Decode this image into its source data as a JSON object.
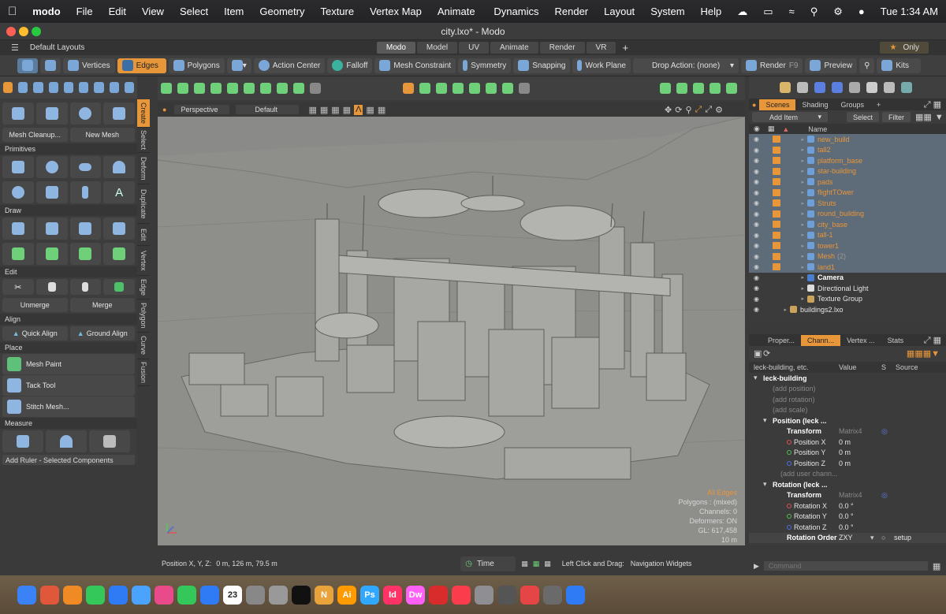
{
  "menubar": {
    "app": "modo",
    "items": [
      "File",
      "Edit",
      "View",
      "Select",
      "Item",
      "Geometry",
      "Texture",
      "Vertex Map",
      "Animate"
    ],
    "right_items": [
      "Dynamics",
      "Render",
      "Layout",
      "System",
      "Help"
    ],
    "clock": "Tue  1:34 AM"
  },
  "window": {
    "title": "city.lxo* - Modo"
  },
  "layoutbar": {
    "layouts_label": "Default Layouts",
    "tabs": [
      "Modo",
      "Model",
      "UV",
      "Animate",
      "Render",
      "VR"
    ],
    "add": "+",
    "only_label": "Only"
  },
  "toolbar": {
    "vertices": "Vertices",
    "edges": "Edges",
    "polygons": "Polygons",
    "action_center": "Action Center",
    "falloff": "Falloff",
    "mesh_constraint": "Mesh Constraint",
    "symmetry": "Symmetry",
    "snapping": "Snapping",
    "work_plane": "Work Plane",
    "drop_action": "Drop Action: (none)",
    "render": "Render",
    "render_key": "F9",
    "preview": "Preview",
    "kits": "Kits"
  },
  "left": {
    "mesh_cleanup": "Mesh Cleanup...",
    "new_mesh": "New Mesh",
    "sections": {
      "primitives": "Primitives",
      "draw": "Draw",
      "edit": "Edit",
      "align": "Align",
      "place": "Place",
      "measure": "Measure"
    },
    "unmerge": "Unmerge",
    "merge": "Merge",
    "quick_align": "Quick Align",
    "ground_align": "Ground Align",
    "mesh_paint": "Mesh Paint",
    "tack_tool": "Tack Tool",
    "stitch_mesh": "Stitch Mesh...",
    "add_ruler": "Add Ruler - Selected Components",
    "vtabs": [
      "Create",
      "Select",
      "Deform",
      "Duplicate",
      "Edit",
      "Vertex",
      "Edge",
      "Polygon",
      "Curve",
      "Fusion"
    ]
  },
  "viewport": {
    "view": "Perspective",
    "shading": "Default",
    "hud": {
      "all_edges": "All Edges",
      "polygons": "Polygons : (mixed)",
      "channels": "Channels: 0",
      "deformers": "Deformers: ON",
      "gl": "GL: 617,458",
      "scale": "10 m"
    }
  },
  "statusbar": {
    "position_label": "Position X, Y, Z:",
    "position_value": "0 m, 126 m, 79.5 m",
    "time": "Time",
    "hint_action": "Left Click and Drag:",
    "hint_target": "Navigation Widgets"
  },
  "scenes": {
    "tabs": [
      "Scenes",
      "Shading",
      "Groups",
      "+"
    ],
    "add_item": "Add Item",
    "select": "Select",
    "filter": "Filter",
    "name_header": "Name",
    "items": [
      {
        "name": "new_build",
        "type": "mesh",
        "selected": true
      },
      {
        "name": "tall2",
        "type": "mesh",
        "selected": true
      },
      {
        "name": "platform_base",
        "type": "mesh",
        "selected": true
      },
      {
        "name": "star-building",
        "type": "mesh",
        "selected": true
      },
      {
        "name": "pads",
        "type": "mesh",
        "selected": true
      },
      {
        "name": "flightTOwer",
        "type": "mesh",
        "selected": true
      },
      {
        "name": "Struts",
        "type": "mesh",
        "selected": true
      },
      {
        "name": "round_building",
        "type": "mesh",
        "selected": true
      },
      {
        "name": "city_base",
        "type": "mesh",
        "selected": true
      },
      {
        "name": "tall-1",
        "type": "mesh",
        "selected": true
      },
      {
        "name": "tower1",
        "type": "mesh",
        "selected": true
      },
      {
        "name": "Mesh",
        "count": "(2)",
        "type": "mesh",
        "selected": true
      },
      {
        "name": "land1",
        "type": "mesh",
        "selected": true
      },
      {
        "name": "Camera",
        "type": "camera",
        "selected": false
      },
      {
        "name": "Directional Light",
        "type": "light",
        "selected": false
      },
      {
        "name": "Texture Group",
        "type": "texture",
        "selected": false
      },
      {
        "name": "buildings2.lxo",
        "type": "scene",
        "selected": false
      }
    ]
  },
  "channels": {
    "tabs": [
      "Proper...",
      "Chann...",
      "Vertex ...",
      "Stats"
    ],
    "headers": {
      "name": "leck-building, etc.",
      "value": "Value",
      "s": "S",
      "source": "Source"
    },
    "rows": [
      {
        "label": "leck-building",
        "value": "",
        "kind": "item",
        "indent": 18
      },
      {
        "label": "(add position)",
        "value": "",
        "kind": "dim",
        "indent": 30
      },
      {
        "label": "(add rotation)",
        "value": "",
        "kind": "dim",
        "indent": 30
      },
      {
        "label": "(add scale)",
        "value": "",
        "kind": "dim",
        "indent": 30
      },
      {
        "label": "Position (leck ...",
        "value": "",
        "kind": "group",
        "indent": 30
      },
      {
        "label": "Transform",
        "value": "Matrix4",
        "kind": "plain",
        "indent": 48
      },
      {
        "label": "Position X",
        "value": "0 m",
        "kind": "x",
        "indent": 48
      },
      {
        "label": "Position Y",
        "value": "0 m",
        "kind": "y",
        "indent": 48
      },
      {
        "label": "Position Z",
        "value": "0 m",
        "kind": "z",
        "indent": 48
      },
      {
        "label": "(add user chann...",
        "value": "",
        "kind": "dim",
        "indent": 40
      },
      {
        "label": "Rotation (leck ...",
        "value": "",
        "kind": "group",
        "indent": 30
      },
      {
        "label": "Transform",
        "value": "Matrix4",
        "kind": "plain",
        "indent": 48
      },
      {
        "label": "Rotation X",
        "value": "0.0 °",
        "kind": "x",
        "indent": 48
      },
      {
        "label": "Rotation Y",
        "value": "0.0 °",
        "kind": "y",
        "indent": 48
      },
      {
        "label": "Rotation Z",
        "value": "0.0 °",
        "kind": "z",
        "indent": 48
      },
      {
        "label": "Rotation Order",
        "value": "ZXY",
        "kind": "order",
        "indent": 48,
        "source": "setup"
      }
    ]
  },
  "command": {
    "placeholder": "Command"
  },
  "dock": {
    "apps": [
      {
        "label": "",
        "color": "#3b82f6"
      },
      {
        "label": "",
        "color": "#e1573a"
      },
      {
        "label": "",
        "color": "#f08a24"
      },
      {
        "label": "",
        "color": "#34c759"
      },
      {
        "label": "",
        "color": "#2f7bf5"
      },
      {
        "label": "",
        "color": "#4aa3ff"
      },
      {
        "label": "",
        "color": "#e94b8a"
      },
      {
        "label": "",
        "color": "#34c759"
      },
      {
        "label": "",
        "color": "#2f7bf5"
      },
      {
        "label": "23",
        "color": "#ffffff"
      },
      {
        "label": "",
        "color": "#888888"
      },
      {
        "label": "",
        "color": "#999999"
      },
      {
        "label": "",
        "color": "#111111"
      },
      {
        "label": "N",
        "color": "#e8a33a"
      },
      {
        "label": "Ai",
        "color": "#ff9a00"
      },
      {
        "label": "Ps",
        "color": "#31a8ff"
      },
      {
        "label": "Id",
        "color": "#ff3366"
      },
      {
        "label": "Dw",
        "color": "#ff61f6"
      },
      {
        "label": "",
        "color": "#d82c2c"
      },
      {
        "label": "",
        "color": "#fa3c4c"
      },
      {
        "label": "",
        "color": "#8e8e93"
      },
      {
        "label": "",
        "color": "#555555"
      },
      {
        "label": "",
        "color": "#e64545"
      },
      {
        "label": "",
        "color": "#6a6a6a"
      },
      {
        "label": "",
        "color": "#2f7bf5"
      }
    ]
  }
}
